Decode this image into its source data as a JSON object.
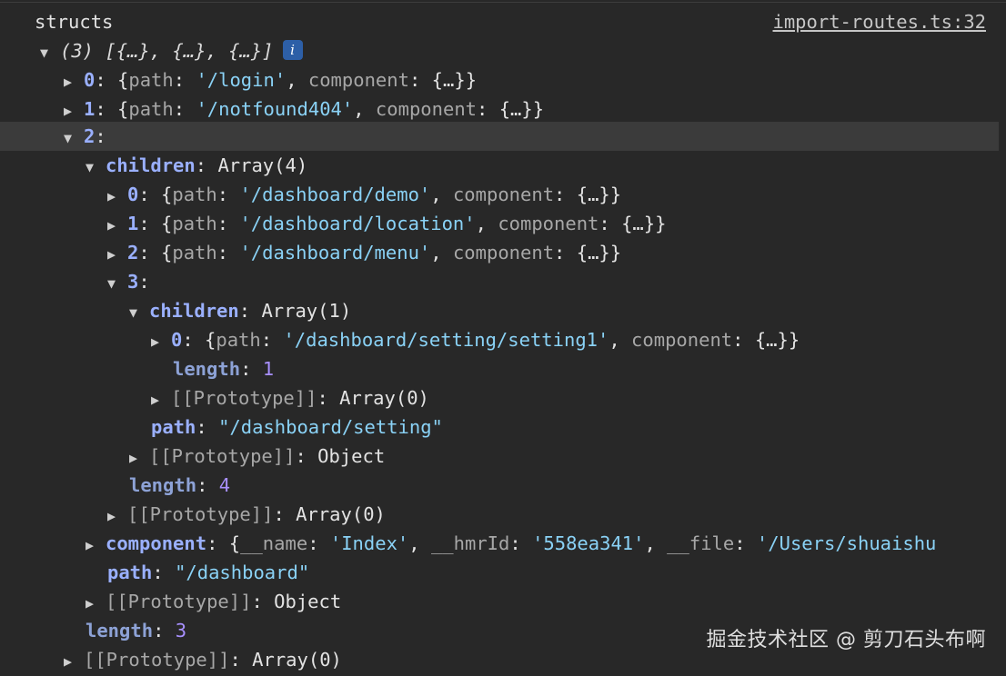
{
  "header": {
    "label": "structs",
    "source_link": "import-routes.ts:32"
  },
  "root": {
    "summary": "(3) [{…}, {…}, {…}]",
    "info_icon_glyph": "i"
  },
  "items": {
    "i0": {
      "key": "0",
      "path_key": "path",
      "path_value": "'/login'",
      "comp_key": "component",
      "comp_value": "{…}"
    },
    "i1": {
      "key": "1",
      "path_key": "path",
      "path_value": "'/notfound404'",
      "comp_key": "component",
      "comp_value": "{…}"
    },
    "i2": {
      "key": "2",
      "children_key": "children",
      "children_value": "Array(4)",
      "c0": {
        "key": "0",
        "path_key": "path",
        "path_value": "'/dashboard/demo'",
        "comp_key": "component",
        "comp_value": "{…}"
      },
      "c1": {
        "key": "1",
        "path_key": "path",
        "path_value": "'/dashboard/location'",
        "comp_key": "component",
        "comp_value": "{…}"
      },
      "c2": {
        "key": "2",
        "path_key": "path",
        "path_value": "'/dashboard/menu'",
        "comp_key": "component",
        "comp_value": "{…}"
      },
      "c3": {
        "key": "3",
        "children_key": "children",
        "children_value": "Array(1)",
        "g0": {
          "key": "0",
          "path_key": "path",
          "path_value": "'/dashboard/setting/setting1'",
          "comp_key": "component",
          "comp_value": "{…}"
        },
        "length_key": "length",
        "length_value": "1",
        "proto_arr_key": "[[Prototype]]",
        "proto_arr_value": "Array(0)",
        "path_key": "path",
        "path_value": "\"/dashboard/setting\"",
        "proto_obj_key": "[[Prototype]]",
        "proto_obj_value": "Object"
      },
      "length_key": "length",
      "length_value": "4",
      "proto_key": "[[Prototype]]",
      "proto_value": "Array(0)",
      "component_key": "component",
      "component_value": {
        "name_key": "__name",
        "name_value": "'Index'",
        "hmr_key": "__hmrId",
        "hmr_value": "'558ea341'",
        "file_key": "__file",
        "file_value": "'/Users/shuaishu"
      },
      "path_key": "path",
      "path_value": "\"/dashboard\"",
      "proto_obj_key": "[[Prototype]]",
      "proto_obj_value": "Object"
    },
    "length_key": "length",
    "length_value": "3",
    "proto_key": "[[Prototype]]",
    "proto_value": "Array(0)"
  },
  "watermark": "掘金技术社区 @ 剪刀石头布啊"
}
